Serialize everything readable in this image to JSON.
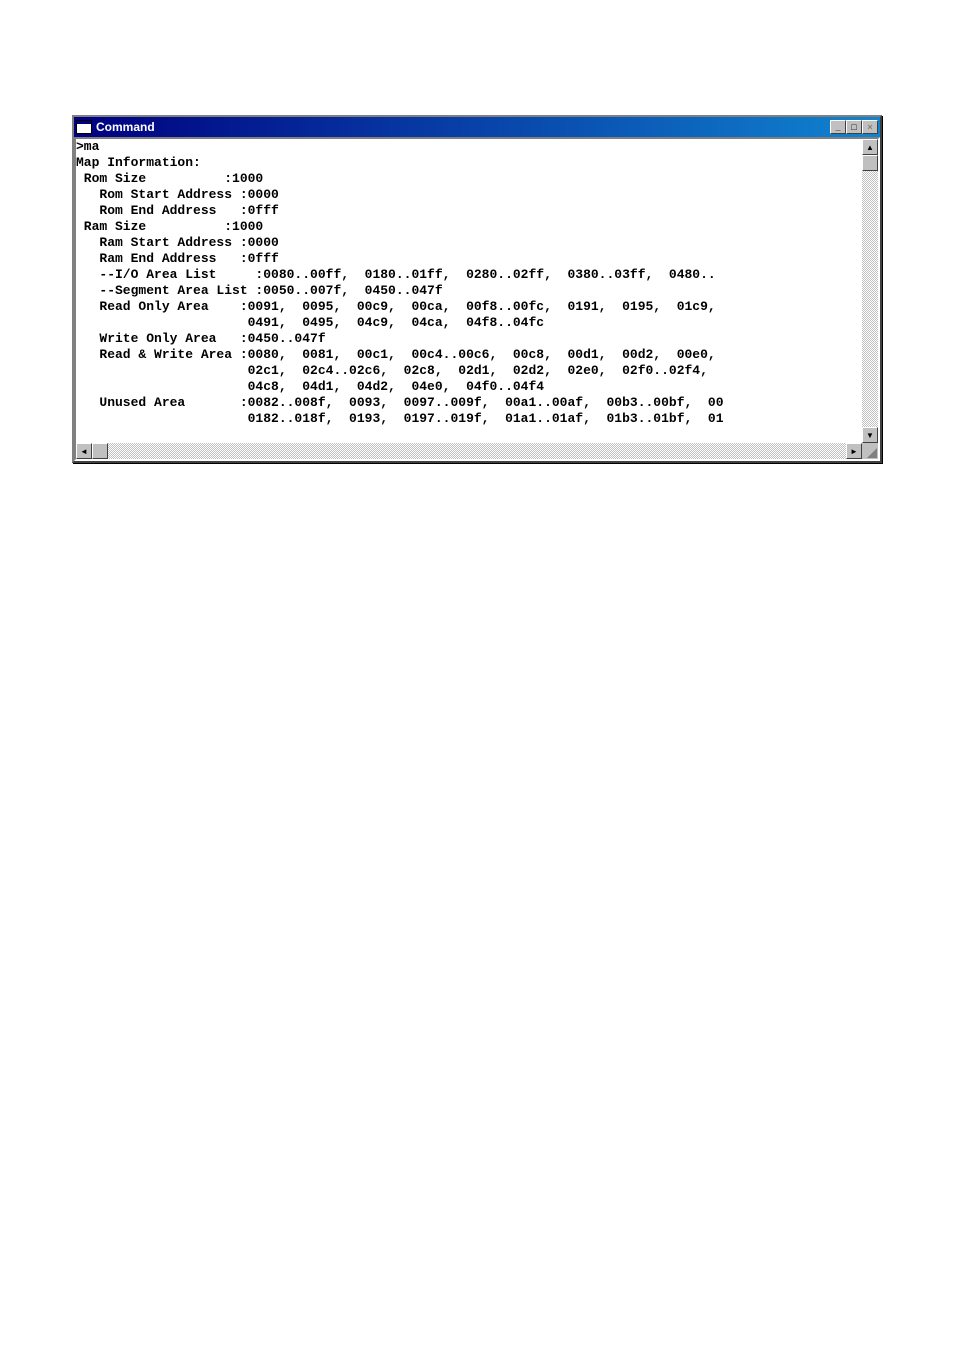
{
  "window": {
    "title": "Command"
  },
  "titlebar_buttons": {
    "minimize": "_",
    "maximize": "□",
    "close": "×"
  },
  "terminal": {
    "lines": [
      ">ma",
      "Map Information:",
      " Rom Size          :1000",
      "   Rom Start Address :0000",
      "   Rom End Address   :0fff",
      " Ram Size          :1000",
      "   Ram Start Address :0000",
      "   Ram End Address   :0fff",
      "   --I/O Area List     :0080..00ff,  0180..01ff,  0280..02ff,  0380..03ff,  0480..",
      "   --Segment Area List :0050..007f,  0450..047f",
      "   Read Only Area    :0091,  0095,  00c9,  00ca,  00f8..00fc,  0191,  0195,  01c9,",
      "                      0491,  0495,  04c9,  04ca,  04f8..04fc",
      "   Write Only Area   :0450..047f",
      "   Read & Write Area :0080,  0081,  00c1,  00c4..00c6,  00c8,  00d1,  00d2,  00e0,",
      "                      02c1,  02c4..02c6,  02c8,  02d1,  02d2,  02e0,  02f0..02f4,",
      "                      04c8,  04d1,  04d2,  04e0,  04f0..04f4",
      "   Unused Area       :0082..008f,  0093,  0097..009f,  00a1..00af,  00b3..00bf,  00",
      "                      0182..018f,  0193,  0197..019f,  01a1..01af,  01b3..01bf,  01"
    ]
  },
  "scrollbar": {
    "up": "▲",
    "down": "▼",
    "left": "◄",
    "right": "►"
  }
}
